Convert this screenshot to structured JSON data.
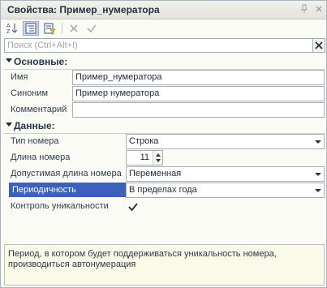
{
  "window": {
    "title": "Свойства: Пример_нумератора",
    "pin_icon": "pin-icon",
    "close_icon": "close-icon"
  },
  "toolbar": {
    "icons": [
      "sort-alpha-icon",
      "categories-icon",
      "filter-icon",
      "clear-icon",
      "check-icon"
    ],
    "active_index": 1
  },
  "search": {
    "placeholder": "Поиск (Ctrl+Alt+I)",
    "clear_icon": "close-icon"
  },
  "groups": {
    "main": "Основные:",
    "data": "Данные:"
  },
  "props": {
    "name": {
      "label": "Имя",
      "value": "Пример_нумератора"
    },
    "synonym": {
      "label": "Синоним",
      "value": "Пример нумератора"
    },
    "comment": {
      "label": "Комментарий",
      "value": ""
    },
    "number_type": {
      "label": "Тип номера",
      "value": "Строка"
    },
    "number_length": {
      "label": "Длина номера",
      "value": "11"
    },
    "allowed_length": {
      "label": "Допустимая длина номера",
      "value": "Переменная"
    },
    "periodicity": {
      "label": "Периодичность",
      "value": "В пределах года"
    },
    "uniqueness": {
      "label": "Контроль уникальности",
      "checked": true
    }
  },
  "footer": {
    "text": "Период, в котором будет поддерживаться уникальность номера, производиться автонумерация"
  },
  "colors": {
    "selection": "#3d5fbd",
    "dropdown_arrow": "#333333",
    "footer_bg": "#fbf9e8"
  }
}
